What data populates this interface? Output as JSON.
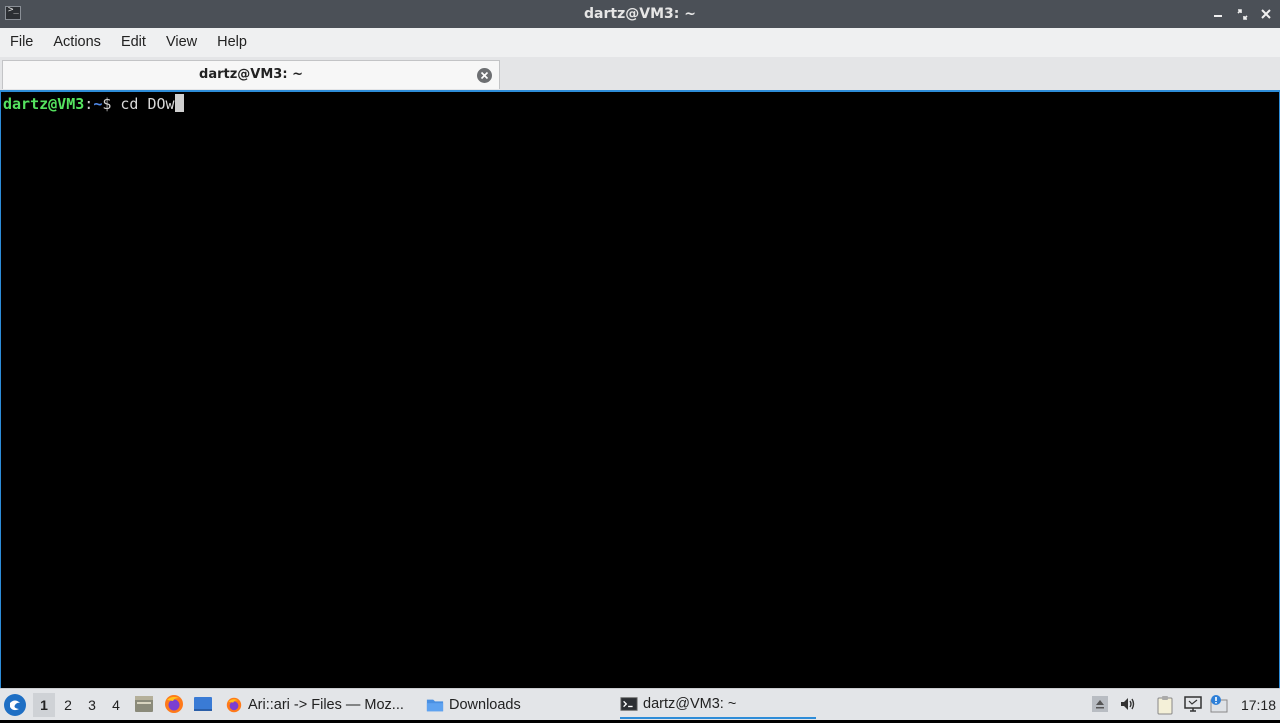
{
  "window": {
    "title": "dartz@VM3: ~",
    "app_icon_glyph": ">_",
    "controls": [
      "minimize-icon",
      "maximize-icon",
      "close-icon"
    ]
  },
  "menubar": {
    "items": [
      {
        "label": "File"
      },
      {
        "label": "Actions"
      },
      {
        "label": "Edit"
      },
      {
        "label": "View"
      },
      {
        "label": "Help"
      }
    ]
  },
  "tabs": [
    {
      "label": "dartz@VM3: ~",
      "active": true
    }
  ],
  "terminal": {
    "prompt_user": "dartz@VM3",
    "prompt_sep": ":",
    "prompt_path": "~",
    "prompt_symbol": "$ ",
    "command": "cd DOw",
    "colors": {
      "user": "#55e35f",
      "path": "#4f87e6",
      "text": "#d8d8d8",
      "background": "#000000",
      "focus_border": "#2d8cd8"
    }
  },
  "taskbar": {
    "workspaces": [
      "1",
      "2",
      "3",
      "4"
    ],
    "active_workspace": "1",
    "quicklaunch": [
      "file-manager-icon",
      "firefox-icon",
      "desktop-icon"
    ],
    "tasks": [
      {
        "label": "Ari::ari -> Files — Moz...",
        "icon": "firefox-icon"
      },
      {
        "label": "Downloads",
        "icon": "folder-icon"
      },
      {
        "label": "dartz@VM3: ~",
        "icon": "terminal-icon",
        "active": true
      }
    ],
    "tray": [
      "eject-icon",
      "volume-icon",
      "clipboard-icon",
      "monitor-icon",
      "update-icon"
    ],
    "clock": "17:18"
  }
}
